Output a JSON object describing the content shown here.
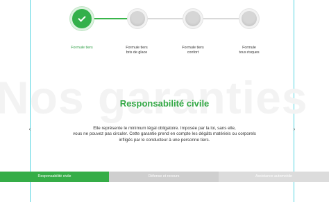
{
  "colors": {
    "accent": "#35ad47",
    "inactive_step": "#d6d6d6",
    "inactive_tab": "#cfcfcf",
    "guide": "#54d4e0"
  },
  "stepper": {
    "progress_fraction": 0.33,
    "steps": [
      {
        "label": "Formule tiers",
        "active": true,
        "icon": "check-icon"
      },
      {
        "label": "Formule tiers\nbris de glace",
        "active": false
      },
      {
        "label": "Formule tiers\nconfort",
        "active": false
      },
      {
        "label": "Formule\ntous risques",
        "active": false
      }
    ]
  },
  "watermark": "Nos garanties",
  "section": {
    "title": "Responsabilité civile",
    "description": "Elle représente le minimum légal obligatoire. Imposée par la loi, sans elle,\nvous ne pouvez pas circuler. Cette garantie prend en compte les dégâts matériels ou corporels\ninfligés par le conducteur à une personne tiers."
  },
  "nav": {
    "prev_icon": "chevron-left-icon",
    "next_icon": "chevron-right-icon",
    "prev_glyph": "‹",
    "next_glyph": "›"
  },
  "tabs": [
    {
      "label": "Responsabilité civile",
      "active": true
    },
    {
      "label": "Défense et recours",
      "active": false
    },
    {
      "label": "Assistance automobile",
      "active": false
    }
  ]
}
